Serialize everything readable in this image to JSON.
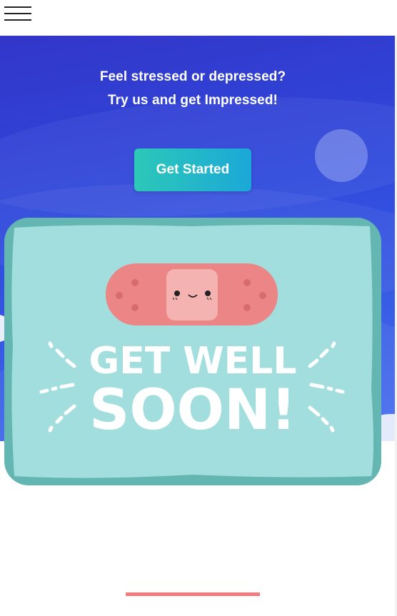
{
  "nav": {
    "menu_icon": "hamburger-menu-icon"
  },
  "hero": {
    "line1": "Feel stressed or depressed?",
    "line2": "Try us and get Impressed!",
    "cta_label": "Get Started"
  },
  "card": {
    "title_line1": "GET WELL",
    "title_line2": "SOON!",
    "illustration": "bandage-character-icon"
  },
  "colors": {
    "hero_gradient_start": "#3236c9",
    "hero_gradient_end": "#4a6ff0",
    "cta_gradient_start": "#2cc8b8",
    "cta_gradient_end": "#1ba8d8",
    "card_fill": "#a3dedf",
    "card_border": "#64b6b2",
    "bandage": "#ec8585",
    "accent_bar": "#f27b80"
  }
}
